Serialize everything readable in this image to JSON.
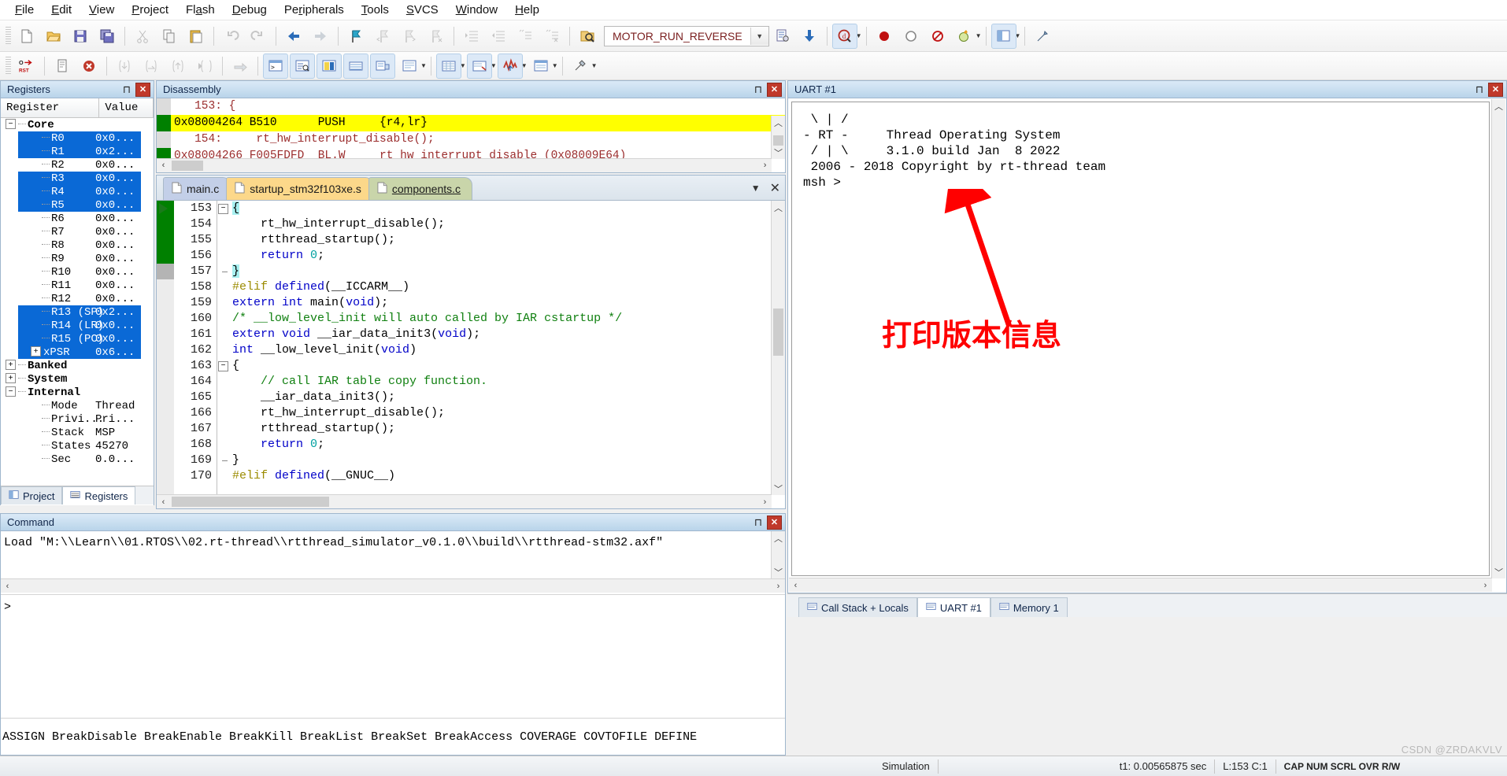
{
  "menu": {
    "items": [
      {
        "label": "File",
        "accel": "F"
      },
      {
        "label": "Edit",
        "accel": "E"
      },
      {
        "label": "View",
        "accel": "V"
      },
      {
        "label": "Project",
        "accel": "P"
      },
      {
        "label": "Flash",
        "accel": "a"
      },
      {
        "label": "Debug",
        "accel": "D"
      },
      {
        "label": "Peripherals",
        "accel": "r"
      },
      {
        "label": "Tools",
        "accel": "T"
      },
      {
        "label": "SVCS",
        "accel": "S"
      },
      {
        "label": "Window",
        "accel": "W"
      },
      {
        "label": "Help",
        "accel": "H"
      }
    ]
  },
  "toolbar1": {
    "target_name": "MOTOR_RUN_REVERSE",
    "icons": [
      "new-file-icon",
      "open-folder-icon",
      "save-icon",
      "save-all-icon",
      "cut-icon",
      "copy-icon",
      "paste-icon",
      "undo-icon",
      "redo-icon",
      "navigate-back-icon",
      "navigate-forward-icon",
      "bookmark-toggle-icon",
      "bookmark-prev-icon",
      "bookmark-next-icon",
      "bookmark-clear-icon",
      "indent-icon",
      "outdent-icon",
      "comment-icon",
      "uncomment-icon",
      "target-options-icon",
      "target-select-dropdown-icon",
      "manage-components-icon",
      "batch-build-icon",
      "debug-session-icon",
      "breakpoint-icon",
      "disable-breakpoint-icon",
      "kill-breakpoints-icon",
      "bookmarks-icon",
      "window-layout-icon",
      "configure-icon"
    ]
  },
  "toolbar2": {
    "icons": [
      "reset-cpu-icon",
      "run-icon",
      "stop-icon",
      "step-into-icon",
      "step-over-icon",
      "step-out-icon",
      "run-to-cursor-icon",
      "show-statement-icon",
      "command-window-icon",
      "disassembly-window-icon",
      "symbols-window-icon",
      "registers-window-icon",
      "call-stack-window-icon",
      "watch-window-icon",
      "memory-window-icon",
      "serial-window-icon",
      "analysis-window-icon",
      "trace-icon",
      "system-viewer-icon",
      "toolbox-icon"
    ]
  },
  "registers": {
    "title": "Registers",
    "columns": [
      "Register",
      "Value"
    ],
    "groups": [
      {
        "name": "Core",
        "expanded": true,
        "rows": [
          {
            "name": "R0",
            "value": "0x0...",
            "selected": true
          },
          {
            "name": "R1",
            "value": "0x2...",
            "selected": true
          },
          {
            "name": "R2",
            "value": "0x0...",
            "selected": false
          },
          {
            "name": "R3",
            "value": "0x0...",
            "selected": true
          },
          {
            "name": "R4",
            "value": "0x0...",
            "selected": true
          },
          {
            "name": "R5",
            "value": "0x0...",
            "selected": true
          },
          {
            "name": "R6",
            "value": "0x0...",
            "selected": false
          },
          {
            "name": "R7",
            "value": "0x0...",
            "selected": false
          },
          {
            "name": "R8",
            "value": "0x0...",
            "selected": false
          },
          {
            "name": "R9",
            "value": "0x0...",
            "selected": false
          },
          {
            "name": "R10",
            "value": "0x0...",
            "selected": false
          },
          {
            "name": "R11",
            "value": "0x0...",
            "selected": false
          },
          {
            "name": "R12",
            "value": "0x0...",
            "selected": false
          },
          {
            "name": "R13 (SP)",
            "value": "0x2...",
            "selected": true
          },
          {
            "name": "R14 (LR)",
            "value": "0x0...",
            "selected": true
          },
          {
            "name": "R15 (PC)",
            "value": "0x0...",
            "selected": true
          },
          {
            "name": "xPSR",
            "value": "0x6...",
            "selected": true,
            "expandable": true
          }
        ]
      },
      {
        "name": "Banked",
        "expanded": false,
        "rows": []
      },
      {
        "name": "System",
        "expanded": false,
        "rows": []
      },
      {
        "name": "Internal",
        "expanded": true,
        "rows": [
          {
            "name": "Mode",
            "value": "Thread",
            "selected": false
          },
          {
            "name": "Privi...",
            "value": "Pri...",
            "selected": false
          },
          {
            "name": "Stack",
            "value": "MSP",
            "selected": false
          },
          {
            "name": "States",
            "value": "45270",
            "selected": false
          },
          {
            "name": "Sec",
            "value": "0.0...",
            "selected": false
          }
        ]
      }
    ],
    "tabs": [
      {
        "label": "Project",
        "icon": "project-icon",
        "active": false
      },
      {
        "label": "Registers",
        "icon": "registers-icon",
        "active": true
      }
    ]
  },
  "disassembly": {
    "title": "Disassembly",
    "lines": [
      {
        "text": "   153: {",
        "kind": "source",
        "current": false
      },
      {
        "text": "0x08004264 B510      PUSH     {r4,lr}",
        "kind": "asm",
        "current": true
      },
      {
        "text": "   154:     rt_hw_interrupt_disable();",
        "kind": "source",
        "current": false
      },
      {
        "text": "0x08004266 F005FDFD  BL.W     rt_hw_interrupt_disable (0x08009E64)",
        "kind": "asm",
        "current": false
      }
    ]
  },
  "editor": {
    "tabs": [
      {
        "label": "main.c",
        "active": false,
        "color": "blue"
      },
      {
        "label": "startup_stm32f103xe.s",
        "active": false,
        "color": "orange"
      },
      {
        "label": "components.c",
        "active": true,
        "color": "green"
      }
    ],
    "lines": [
      {
        "n": "153",
        "text": "{",
        "fold": "start",
        "marker": "arrow",
        "bar": "green",
        "brace": true
      },
      {
        "n": "154",
        "text": "    rt_hw_interrupt_disable();",
        "bar": "green"
      },
      {
        "n": "155",
        "text": "    rtthread_startup();",
        "bar": "green"
      },
      {
        "n": "156",
        "text": "    return 0;",
        "kw": "return",
        "numlit": "0",
        "bar": "green"
      },
      {
        "n": "157",
        "text": "}",
        "fold": "end",
        "bar": "gray",
        "brace": true
      },
      {
        "n": "158",
        "text": "#elif defined(__ICCARM__)",
        "cls": "pp"
      },
      {
        "n": "159",
        "text": "extern int main(void);",
        "code": "decl"
      },
      {
        "n": "160",
        "text": "/* __low_level_init will auto called by IAR cstartup */",
        "cls": "cm"
      },
      {
        "n": "161",
        "text": "extern void __iar_data_init3(void);",
        "code": "decl"
      },
      {
        "n": "162",
        "text": "int __low_level_init(void)",
        "code": "decl"
      },
      {
        "n": "163",
        "text": "{",
        "fold": "start"
      },
      {
        "n": "164",
        "text": "    // call IAR table copy function.",
        "cls": "cm"
      },
      {
        "n": "165",
        "text": "    __iar_data_init3();"
      },
      {
        "n": "166",
        "text": "    rt_hw_interrupt_disable();"
      },
      {
        "n": "167",
        "text": "    rtthread_startup();"
      },
      {
        "n": "168",
        "text": "    return 0;",
        "kw": "return",
        "numlit": "0"
      },
      {
        "n": "169",
        "text": "}",
        "fold": "end"
      },
      {
        "n": "170",
        "text": "#elif defined(__GNUC__)",
        "cls": "pp"
      }
    ]
  },
  "command": {
    "title": "Command",
    "output": "Load \"M:\\\\Learn\\\\01.RTOS\\\\02.rt-thread\\\\rtthread_simulator_v0.1.0\\\\build\\\\rtthread-stm32.axf\"",
    "prompt": ">",
    "input_value": "",
    "help_line": "ASSIGN BreakDisable BreakEnable BreakKill BreakList BreakSet BreakAccess COVERAGE COVTOFILE DEFINE"
  },
  "uart": {
    "title": "UART #1",
    "content": " \\ | /\n- RT -     Thread Operating System\n / | \\     3.1.0 build Jan  8 2022\n 2006 - 2018 Copyright by rt-thread team\nmsh >"
  },
  "annotation": {
    "text": "打印版本信息",
    "color": "#ff0000",
    "arrow": "red-arrow-annotation"
  },
  "bottom_tabs": [
    {
      "label": "Call Stack + Locals",
      "icon": "call-stack-icon",
      "active": false
    },
    {
      "label": "UART #1",
      "icon": "uart-icon",
      "active": true
    },
    {
      "label": "Memory 1",
      "icon": "memory-icon",
      "active": false
    }
  ],
  "status": {
    "mode": "Simulation",
    "time": "t1: 0.00565875 sec",
    "cursor": "L:153 C:1",
    "indicators": "CAP NUM SCRL OVR R/W",
    "watermark": "CSDN @ZRDAKVLV"
  }
}
